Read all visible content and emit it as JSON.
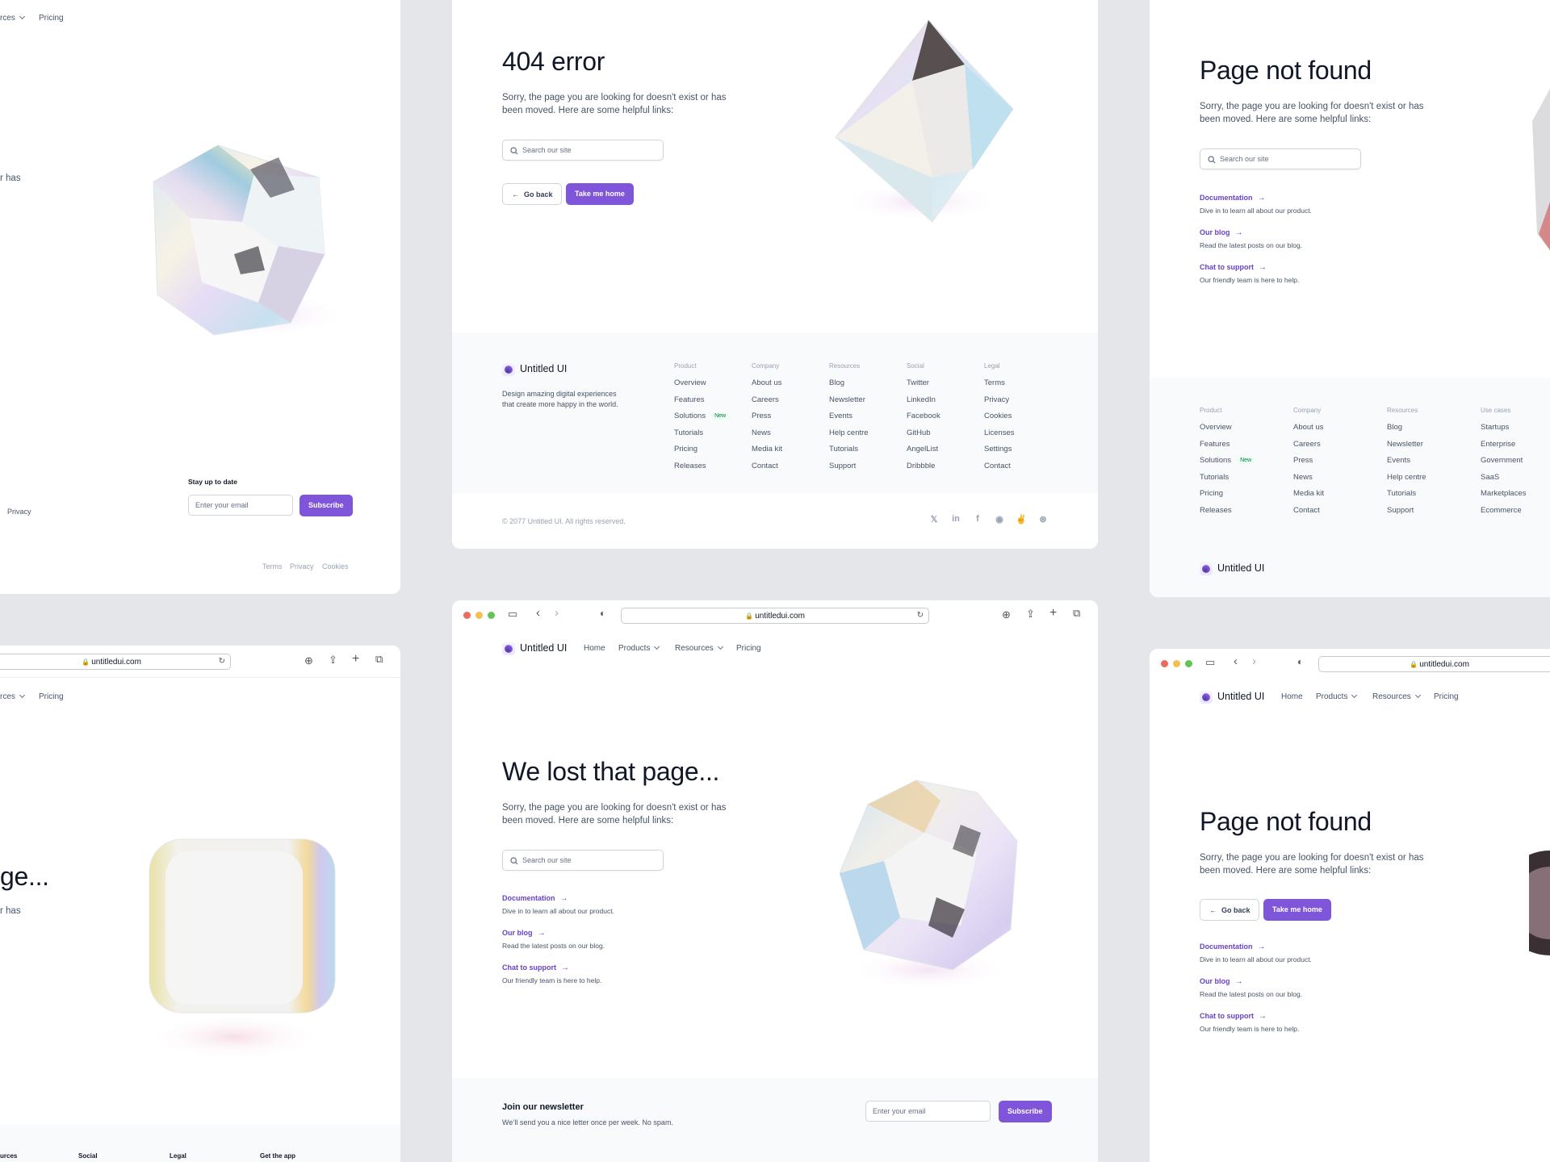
{
  "colors": {
    "brand": "#7f56d9",
    "brand_text": "#6941c6",
    "badge_green": "#027a48"
  },
  "nav": {
    "logo": "Untitled UI",
    "home": "Home",
    "products": "Products",
    "resources": "Resources",
    "pricing": "Pricing",
    "resources_cut": "rces",
    "resources_cut2": "rces"
  },
  "browser": {
    "url": "untitledui.com"
  },
  "common": {
    "subtitle": "Sorry, the page you are looking for doesn't exist or has been moved. Here are some helpful links:",
    "search_placeholder": "Search our site",
    "go_back": "Go back",
    "take_home": "Take me home",
    "links": [
      {
        "title": "Documentation",
        "desc": "Dive in to learn all about our product."
      },
      {
        "title": "Our blog",
        "desc": "Read the latest posts on our blog."
      },
      {
        "title": "Chat to support",
        "desc": "Our friendly team is here to help."
      }
    ]
  },
  "card_404": {
    "title": "404 error"
  },
  "card_lost": {
    "title": "We lost that page..."
  },
  "card_pnf": {
    "title": "Page not found"
  },
  "card_pnf2": {
    "title": "Page not found"
  },
  "card_left_top": {
    "sub_cut": "r has",
    "stay": "Stay up to date",
    "email_placeholder": "Enter your email",
    "subscribe": "Subscribe",
    "privacy": "Privacy",
    "bottom_links": [
      "Terms",
      "Privacy",
      "Cookies"
    ]
  },
  "card_left_bottom": {
    "title_cut": "ge...",
    "sub_cut": "r has",
    "footer_cols": [
      "urces",
      "Social",
      "Legal",
      "Get the app"
    ]
  },
  "footer": {
    "tagline": "Design amazing digital experiences that create more happy in the world.",
    "copyright": "© 2077 Untitled UI. All rights reserved.",
    "new_badge": "New",
    "columns": [
      {
        "title": "Product",
        "items": [
          "Overview",
          "Features",
          "Solutions",
          "Tutorials",
          "Pricing",
          "Releases"
        ]
      },
      {
        "title": "Company",
        "items": [
          "About us",
          "Careers",
          "Press",
          "News",
          "Media kit",
          "Contact"
        ]
      },
      {
        "title": "Resources",
        "items": [
          "Blog",
          "Newsletter",
          "Events",
          "Help centre",
          "Tutorials",
          "Support"
        ]
      },
      {
        "title": "Social",
        "items": [
          "Twitter",
          "LinkedIn",
          "Facebook",
          "GitHub",
          "AngelList",
          "Dribbble"
        ]
      },
      {
        "title": "Legal",
        "items": [
          "Terms",
          "Privacy",
          "Cookies",
          "Licenses",
          "Settings",
          "Contact"
        ]
      }
    ],
    "columns_right": [
      {
        "title": "Product",
        "items": [
          "Overview",
          "Features",
          "Solutions",
          "Tutorials",
          "Pricing",
          "Releases"
        ]
      },
      {
        "title": "Company",
        "items": [
          "About us",
          "Careers",
          "Press",
          "News",
          "Media kit",
          "Contact"
        ]
      },
      {
        "title": "Resources",
        "items": [
          "Blog",
          "Newsletter",
          "Events",
          "Help centre",
          "Tutorials",
          "Support"
        ]
      },
      {
        "title": "Use cases",
        "items": [
          "Startups",
          "Enterprise",
          "Government",
          "SaaS",
          "Marketplaces",
          "Ecommerce"
        ]
      }
    ]
  },
  "newsletter": {
    "title": "Join our newsletter",
    "desc": "We’ll send you a nice letter once per week. No spam.",
    "email_placeholder": "Enter your email",
    "subscribe": "Subscribe"
  },
  "social_icons": [
    "twitter-icon",
    "linkedin-icon",
    "facebook-icon",
    "github-icon",
    "angellist-icon",
    "dribbble-icon"
  ]
}
